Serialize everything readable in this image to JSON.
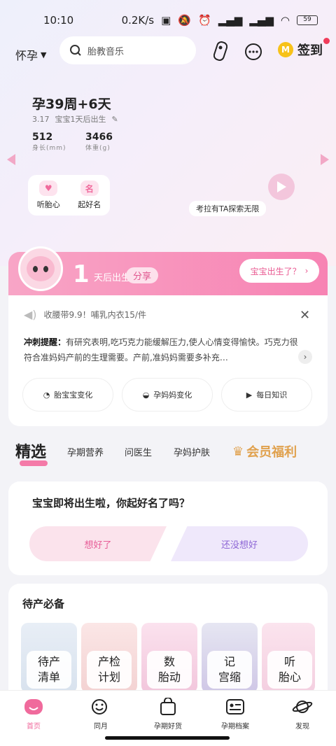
{
  "status": {
    "time": "10:10",
    "speed": "0.2K/s",
    "battery": "59"
  },
  "header": {
    "location": "怀孕",
    "search_placeholder": "胎教音乐",
    "signin": "签到",
    "coin": "M"
  },
  "pregnancy": {
    "week": "孕39周+6天",
    "birth_date": "3.17",
    "birth_note": "宝宝1天后出生",
    "height_value": "512",
    "height_label": "身长(mm)",
    "weight_value": "3466",
    "weight_label": "体重(g)"
  },
  "tools": [
    {
      "icon": "heart-monitor-icon",
      "label": "听胎心"
    },
    {
      "icon": "name-icon",
      "label": "起好名"
    }
  ],
  "video_caption": "考拉有TA探索无限",
  "birth_card": {
    "days": "1",
    "text": "天后出生",
    "share": "分享",
    "question_btn": "宝宝出生了？"
  },
  "notice": "收腰带9.9！哺乳内衣15/件",
  "tip": {
    "label": "冲刺提醒：",
    "text": "有研究表明,吃巧克力能缓解压力,使人心情变得愉快。巧克力很符合准妈妈产前的生理需要。产前,准妈妈需要多补充…"
  },
  "quick_links": [
    "胎宝宝变化",
    "孕妈妈变化",
    "每日知识"
  ],
  "tabs": {
    "selected": "精选",
    "items": [
      "孕期营养",
      "问医生",
      "孕妈护肤"
    ],
    "vip": "会员福利"
  },
  "name_question": {
    "question": "宝宝即将出生啦，你起好名了吗？",
    "yes": "想好了",
    "no": "还没想好"
  },
  "essentials": {
    "title": "待产必备",
    "items": [
      {
        "l1": "待产",
        "l2": "清单"
      },
      {
        "l1": "产检",
        "l2": "计划"
      },
      {
        "l1": "数",
        "l2": "胎动"
      },
      {
        "l1": "记",
        "l2": "宫缩"
      },
      {
        "l1": "听",
        "l2": "胎心"
      }
    ]
  },
  "nav": [
    "首页",
    "同月",
    "孕期好货",
    "孕期档案",
    "发现"
  ]
}
